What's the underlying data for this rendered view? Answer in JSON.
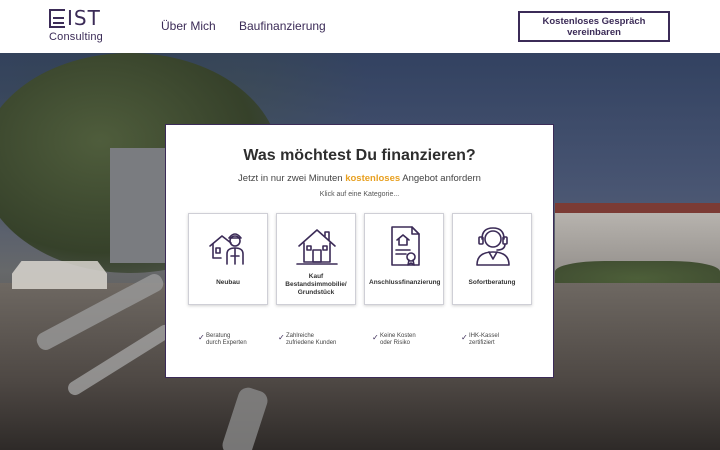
{
  "header": {
    "logo": {
      "mark": "IST",
      "sub": "Consulting"
    },
    "nav": [
      "Über Mich",
      "Baufinanzierung"
    ],
    "cta": "Kostenloses Gespräch vereinbaren"
  },
  "card": {
    "title": "Was möchtest Du finanzieren?",
    "subtitle_pre": "Jetzt in nur zwei Minuten ",
    "subtitle_highlight": "kostenloses",
    "subtitle_post": " Angebot anfordern",
    "hint": "Klick auf eine Kategorie...",
    "options": [
      {
        "label": "Neubau",
        "icon": "worker-house-icon"
      },
      {
        "label": "Kauf Bestandsimmobilie/ Grundstück",
        "icon": "house-icon"
      },
      {
        "label": "Anschlussfinanzierung",
        "icon": "document-house-icon"
      },
      {
        "label": "Sofortberatung",
        "icon": "headset-agent-icon"
      }
    ],
    "trust": [
      {
        "line1": "Beratung",
        "line2": "durch Experten"
      },
      {
        "line1": "Zahlreiche",
        "line2": "zufriedene Kunden"
      },
      {
        "line1": "Keine Kosten",
        "line2": "oder Risiko"
      },
      {
        "line1": "IHK-Kassel",
        "line2": "zertifiziert"
      }
    ]
  },
  "colors": {
    "brand": "#3b2b57",
    "accent": "#e8a020"
  }
}
